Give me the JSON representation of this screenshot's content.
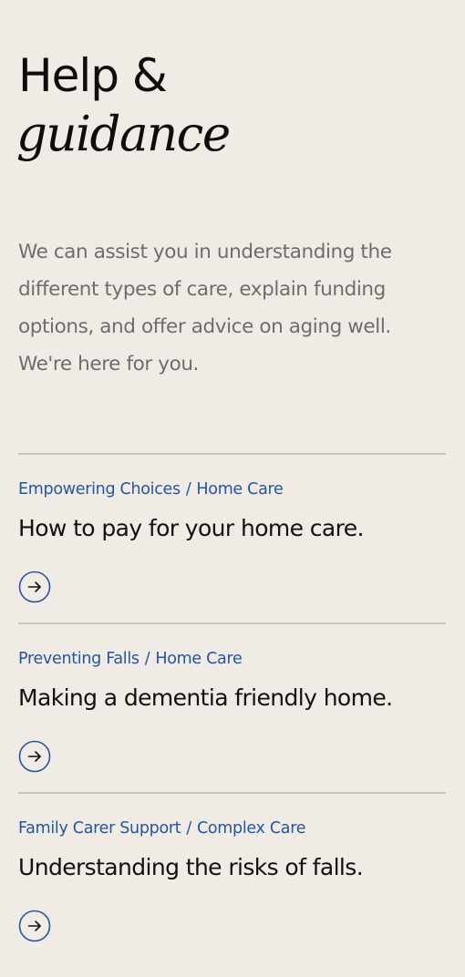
{
  "hero": {
    "title_line1": "Help &",
    "title_line2": "guidance",
    "intro": "We can assist you in understanding the different types of care, explain funding options, and offer advice on aging well. We're here for you."
  },
  "articles": [
    {
      "category": "Empowering Choices",
      "separator": "/",
      "subcategory": "Home Care",
      "title": "How to pay for your home care.",
      "link_icon": "arrow-right-circle-icon"
    },
    {
      "category": "Preventing Falls",
      "separator": "/",
      "subcategory": "Home Care",
      "title": "Making a dementia friendly home.",
      "link_icon": "arrow-right-circle-icon"
    },
    {
      "category": "Family Carer Support",
      "separator": "/",
      "subcategory": "Complex Care",
      "title": "Understanding the risks of falls.",
      "link_icon": "arrow-right-circle-icon"
    }
  ],
  "colors": {
    "background": "#f1ebe6",
    "accent_blue": "#23569f",
    "divider": "#cbc4bc",
    "body_text": "#6d6d6d",
    "heading_text": "#111111"
  }
}
